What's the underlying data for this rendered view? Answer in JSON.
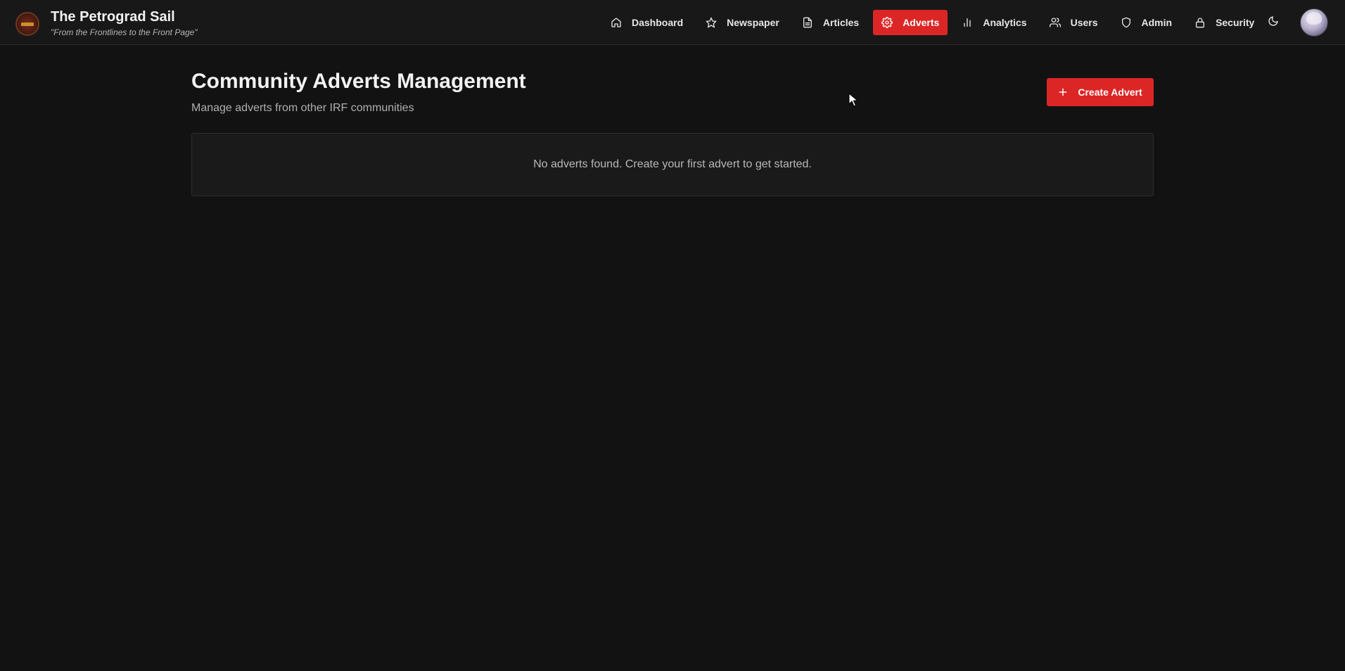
{
  "app": {
    "title": "The Petrograd Sail",
    "tagline": "\"From the Frontlines to the Front Page\""
  },
  "nav": {
    "items": [
      {
        "label": "Dashboard",
        "icon": "home-icon"
      },
      {
        "label": "Newspaper",
        "icon": "star-icon"
      },
      {
        "label": "Articles",
        "icon": "document-icon"
      },
      {
        "label": "Adverts",
        "icon": "gear-icon",
        "active": true
      },
      {
        "label": "Analytics",
        "icon": "bar-chart-icon"
      },
      {
        "label": "Users",
        "icon": "users-icon"
      },
      {
        "label": "Admin",
        "icon": "shield-icon"
      },
      {
        "label": "Security",
        "icon": "lock-icon"
      }
    ],
    "theme_toggle_icon": "moon-icon"
  },
  "page": {
    "title": "Community Adverts Management",
    "subtitle": "Manage adverts from other IRF communities",
    "create_button_label": "Create Advert",
    "create_button_icon": "plus-icon",
    "empty_message": "No adverts found. Create your first advert to get started."
  },
  "colors": {
    "accent": "#dc2626",
    "background": "#121212",
    "header": "#181818"
  }
}
